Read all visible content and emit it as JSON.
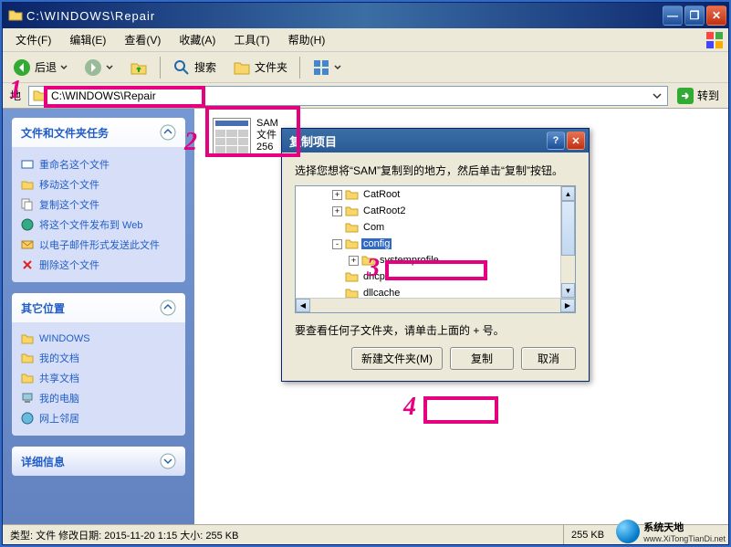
{
  "window": {
    "title": "C:\\WINDOWS\\Repair"
  },
  "menus": [
    "文件(F)",
    "编辑(E)",
    "查看(V)",
    "收藏(A)",
    "工具(T)",
    "帮助(H)"
  ],
  "toolbar": {
    "back": "后退",
    "search": "搜索",
    "folders": "文件夹"
  },
  "address": {
    "label": "地",
    "value": "C:\\WINDOWS\\Repair",
    "go": "转到"
  },
  "sidebar": {
    "tasks_title": "文件和文件夹任务",
    "tasks": [
      "重命名这个文件",
      "移动这个文件",
      "复制这个文件",
      "将这个文件发布到 Web",
      "以电子邮件形式发送此文件",
      "删除这个文件"
    ],
    "other_title": "其它位置",
    "other": [
      "WINDOWS",
      "我的文档",
      "共享文档",
      "我的电脑",
      "网上邻居"
    ],
    "details_title": "详细信息"
  },
  "file": {
    "name": "SAM",
    "type": "文件",
    "size": "256"
  },
  "dialog": {
    "title": "复制项目",
    "prompt": "选择您想将“SAM”复制到的地方，然后单击“复制”按钮。",
    "tree": [
      {
        "indent": 40,
        "exp": "+",
        "name": "CatRoot"
      },
      {
        "indent": 40,
        "exp": "+",
        "name": "CatRoot2"
      },
      {
        "indent": 40,
        "exp": "",
        "name": "Com"
      },
      {
        "indent": 40,
        "exp": "-",
        "name": "config",
        "selected": true
      },
      {
        "indent": 58,
        "exp": "+",
        "name": "systemprofile"
      },
      {
        "indent": 40,
        "exp": "",
        "name": "dhcp"
      },
      {
        "indent": 40,
        "exp": "",
        "name": "dllcache"
      }
    ],
    "hint": "要查看任何子文件夹，请单击上面的 + 号。",
    "new_folder": "新建文件夹(M)",
    "copy": "复制",
    "cancel": "取消"
  },
  "status": {
    "left": "类型: 文件 修改日期: 2015-11-20 1:15 大小: 255 KB",
    "right": "255 KB"
  },
  "annotations": {
    "n1": "1",
    "n2": "2",
    "n3": "3",
    "n4": "4"
  },
  "watermark": {
    "line1": "系统天地",
    "line2": "www.XiTongTianDi.net"
  }
}
